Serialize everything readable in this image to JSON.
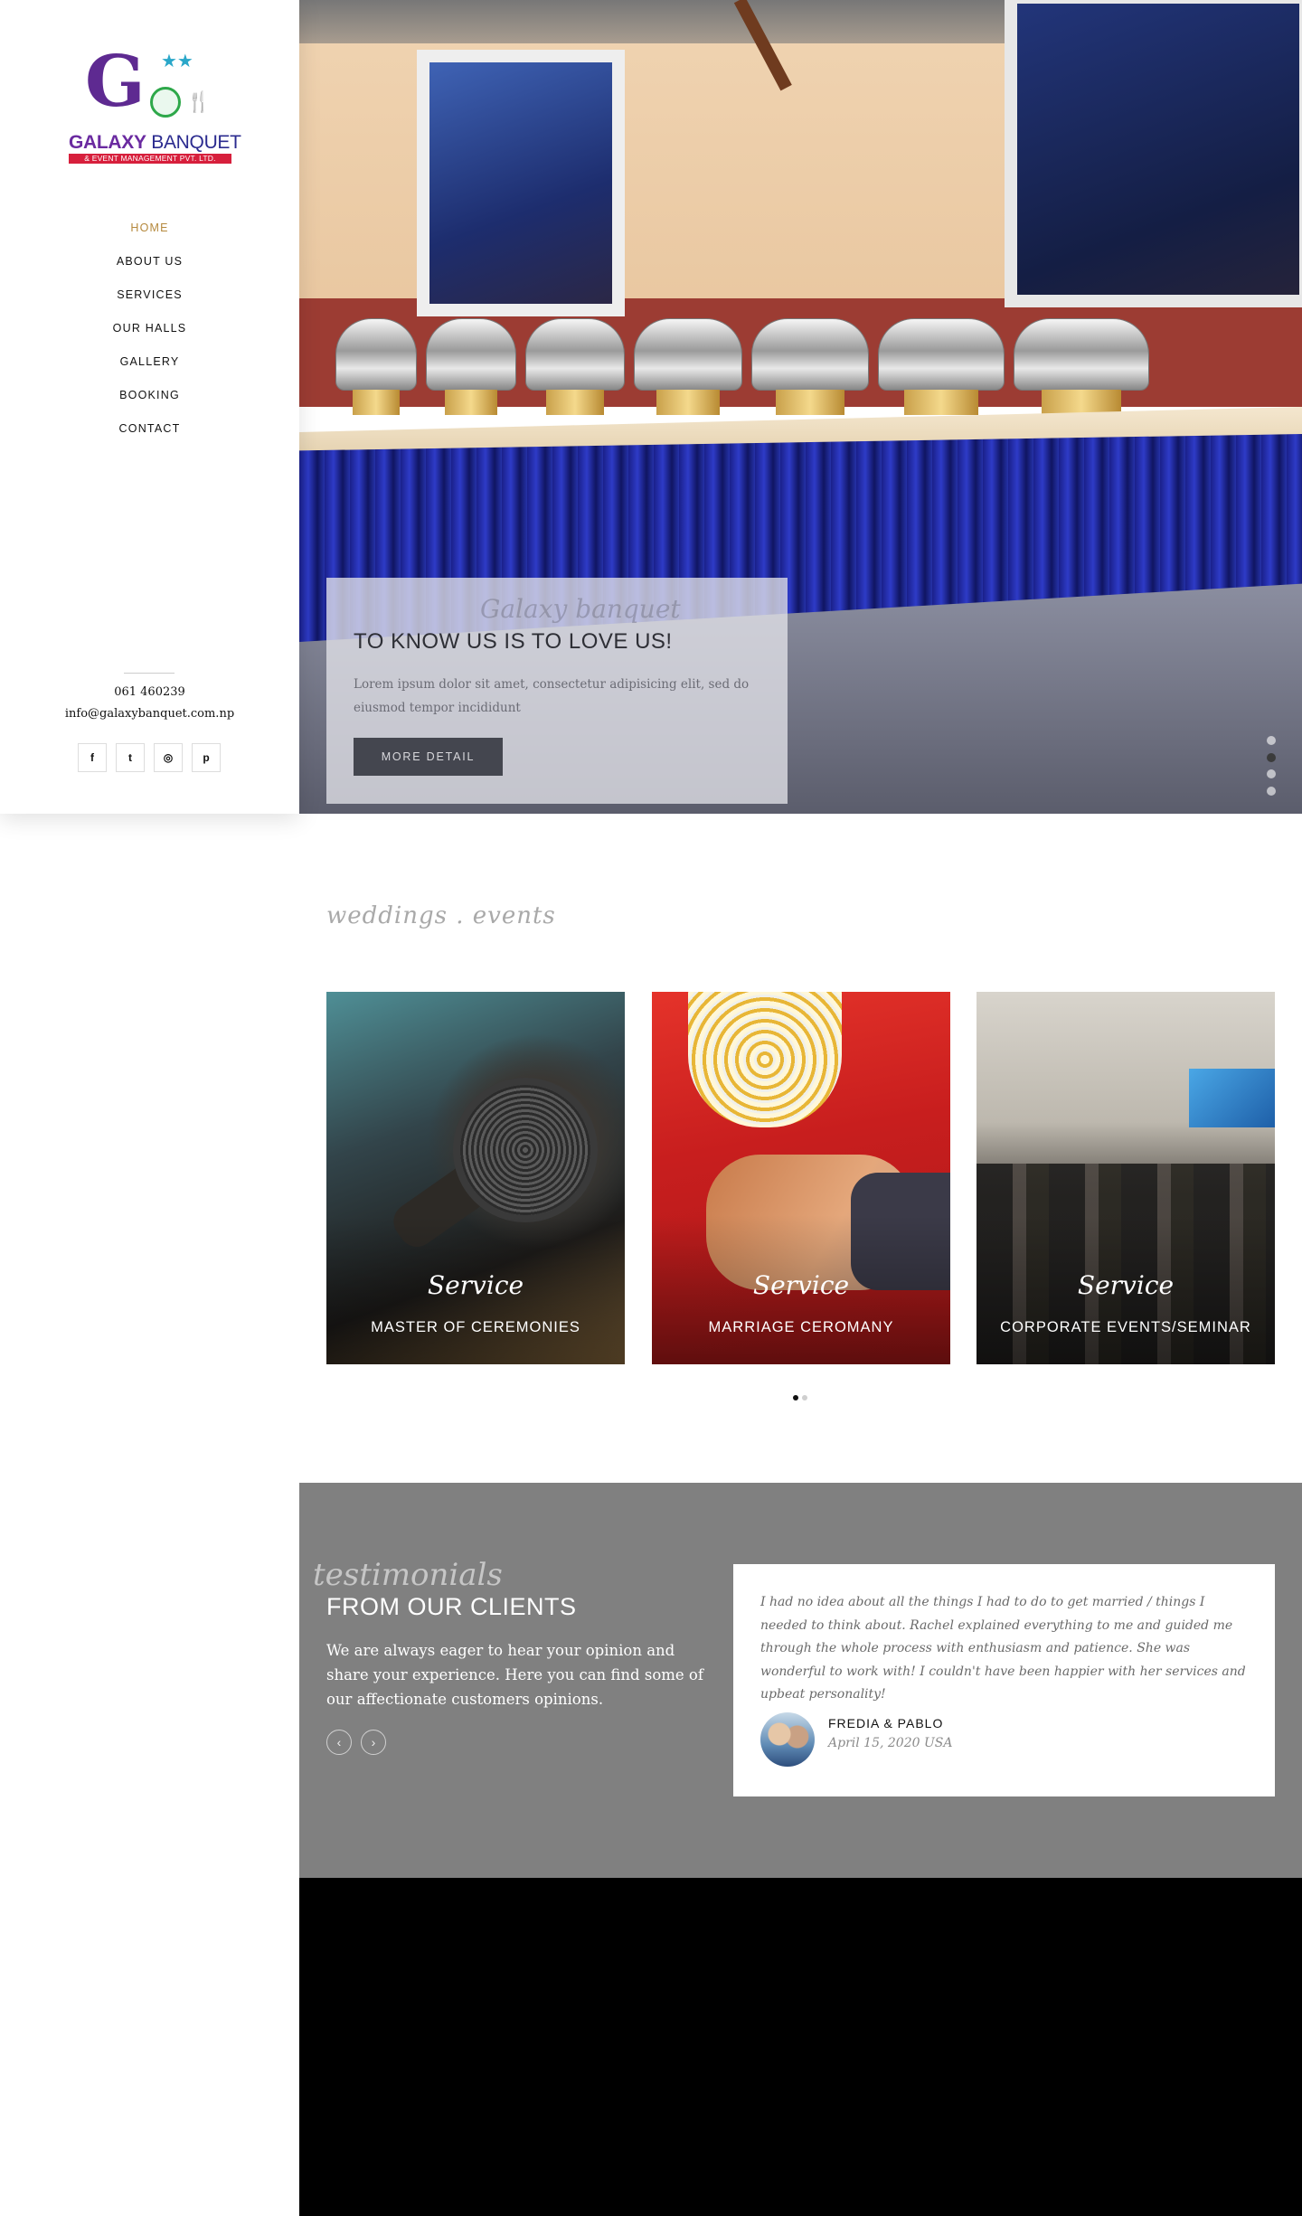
{
  "logo": {
    "brand_part1": "GALAXY",
    "brand_part2": " BANQUET",
    "tagline": "& EVENT MANAGEMENT PVT. LTD."
  },
  "nav": {
    "items": [
      {
        "label": "HOME",
        "active": true
      },
      {
        "label": "ABOUT US"
      },
      {
        "label": "SERVICES"
      },
      {
        "label": "OUR HALLS"
      },
      {
        "label": "GALLERY"
      },
      {
        "label": "BOOKING"
      },
      {
        "label": "CONTACT"
      }
    ]
  },
  "contact": {
    "phone": "061 460239",
    "email": "info@galaxybanquet.com.np"
  },
  "socials": [
    {
      "icon": "facebook-icon",
      "glyph": "f"
    },
    {
      "icon": "twitter-icon",
      "glyph": "t"
    },
    {
      "icon": "instagram-icon",
      "glyph": "◎"
    },
    {
      "icon": "pinterest-icon",
      "glyph": "p"
    }
  ],
  "hero": {
    "script": "Galaxy banquet",
    "headline": "TO KNOW US IS TO LOVE US!",
    "description": "Lorem ipsum dolor sit amet, consectetur adipisicing elit, sed do eiusmod tempor incididunt",
    "button": "MORE DETAIL",
    "slides_total": 4,
    "active_slide": 2
  },
  "services": {
    "script": "weddings . events",
    "cards": [
      {
        "script": "Service",
        "title": "MASTER OF CEREMONIES"
      },
      {
        "script": "Service",
        "title": "MARRIAGE CEROMANY"
      },
      {
        "script": "Service",
        "title": "CORPORATE EVENTS/SEMINAR"
      }
    ],
    "pages_total": 2,
    "active_page": 1
  },
  "testimonials": {
    "script": "testimonials",
    "heading": "FROM OUR CLIENTS",
    "description": "We are always eager to hear your opinion and share your experience. Here you can find some of our affectionate customers opinions.",
    "prev": "‹",
    "next": "›",
    "quote": "I had no idea about all the things I had to do to get married / things I needed to think about. Rachel explained everything to me and guided me through the whole process with enthusiasm and patience. She was wonderful to work with! I couldn't have been happier with her services and upbeat personality!",
    "author": "FREDIA & PABLO",
    "date": "April 15, 2020 USA"
  },
  "colors": {
    "accent": "#b5893d",
    "button": "#44464f",
    "testimonial_bg": "#808080"
  }
}
